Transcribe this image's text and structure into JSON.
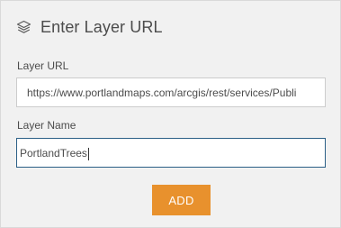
{
  "header": {
    "icon": "layers-icon",
    "title": "Enter Layer URL"
  },
  "form": {
    "url_label": "Layer URL",
    "url_value": "https://www.portlandmaps.com/arcgis/rest/services/Publi",
    "name_label": "Layer Name",
    "name_value": "PortlandTrees",
    "add_label": "ADD"
  },
  "colors": {
    "panel_bg": "#f1f1f1",
    "text": "#4c4c4c",
    "focus_border": "#2b5f86",
    "button_bg": "#e8912d",
    "button_text": "#ffffff"
  }
}
